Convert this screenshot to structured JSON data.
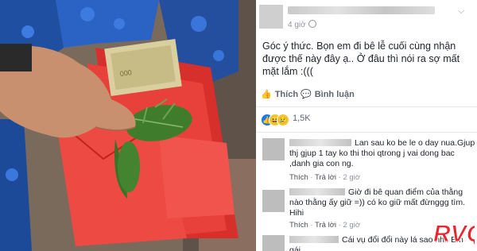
{
  "post": {
    "time": "4 giờ",
    "caption": "Góc ý thức. Bọn em đi bê lễ cuối cùng nhận được thế này đây ạ.. Ở đâu thì nói ra sợ mất mặt lắm :(((",
    "like_label": "Thích",
    "comment_label": "Bình luận",
    "reaction_count": "1,5K"
  },
  "comments": [
    {
      "text_prefix": "Lan sau ko be le o day nua.Gjup thj gjup 1 tay ko thi thoi qtrong j vai dong bac ,danh gia con ng.",
      "like_label": "Thích",
      "reply_label": "Trả lời",
      "time": "2 giờ"
    },
    {
      "text_prefix": "Giờ đi bê quan điểm của thằng nào thằng ấy giữ =)) có ko giữ mất đừnggg tìm. Hihi",
      "like_label": "Thích",
      "reply_label": "Trả lời",
      "time": "2 giờ"
    },
    {
      "text_prefix": "Cái vụ đổi đổi này lá sao nhỉ. Em gái",
      "like_label": "",
      "reply_label": "",
      "time": ""
    }
  ],
  "watermark": {
    "text": "RVQ"
  },
  "colors": {
    "envelope": "#e8403a",
    "facebook_blue": "#1877f2",
    "meta": "#90949c",
    "text": "#1d2129"
  }
}
